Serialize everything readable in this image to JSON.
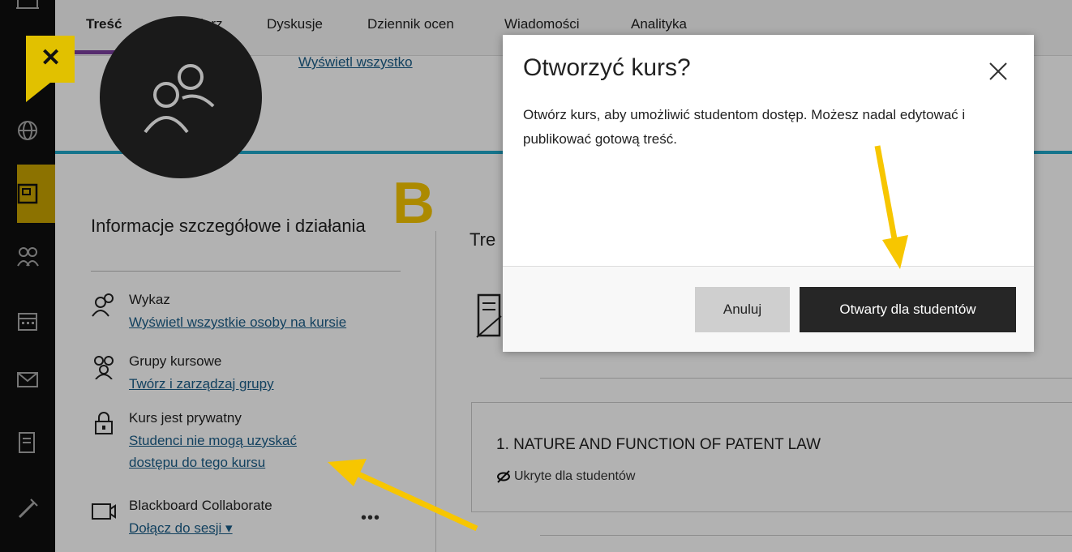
{
  "tabs": [
    "Treść",
    "Kalendarz",
    "Dyskusje",
    "Dziennik ocen",
    "Wiadomości",
    "Analityka"
  ],
  "view_all": "Wyświetl wszystko",
  "annotation_letter": "B",
  "details": {
    "title": "Informacje szczegółowe i działania",
    "roster": {
      "title": "Wykaz",
      "link": "Wyświetl wszystkie osoby na kursie"
    },
    "groups": {
      "title": "Grupy kursowe",
      "link": "Twórz i zarządzaj grupy"
    },
    "privacy": {
      "title": "Kurs jest prywatny",
      "link": "Studenci nie mogą uzyskać dostępu do tego kursu",
      "link_line1": "Studenci nie mogą uzyskać",
      "link_line2": "dostępu do tego kursu"
    },
    "collab": {
      "title": "Blackboard Collaborate",
      "link": "Dołącz do sesji ▾",
      "more": "•••"
    }
  },
  "content": {
    "title_partial": "Tre",
    "module_title": "1. NATURE AND FUNCTION OF PATENT LAW",
    "module_status": "Ukryte dla studentów"
  },
  "modal": {
    "title": "Otworzyć kurs?",
    "body": "Otwórz kurs, aby umożliwić studentom dostęp. Możesz nadal edytować i publikować gotową treść.",
    "cancel": "Anuluj",
    "confirm": "Otwarty dla studentów"
  },
  "colors": {
    "accent_yellow": "#f7c600",
    "tab_underline": "#7b3fa0",
    "teal": "#1fa7c9",
    "link": "#1a5d88"
  }
}
